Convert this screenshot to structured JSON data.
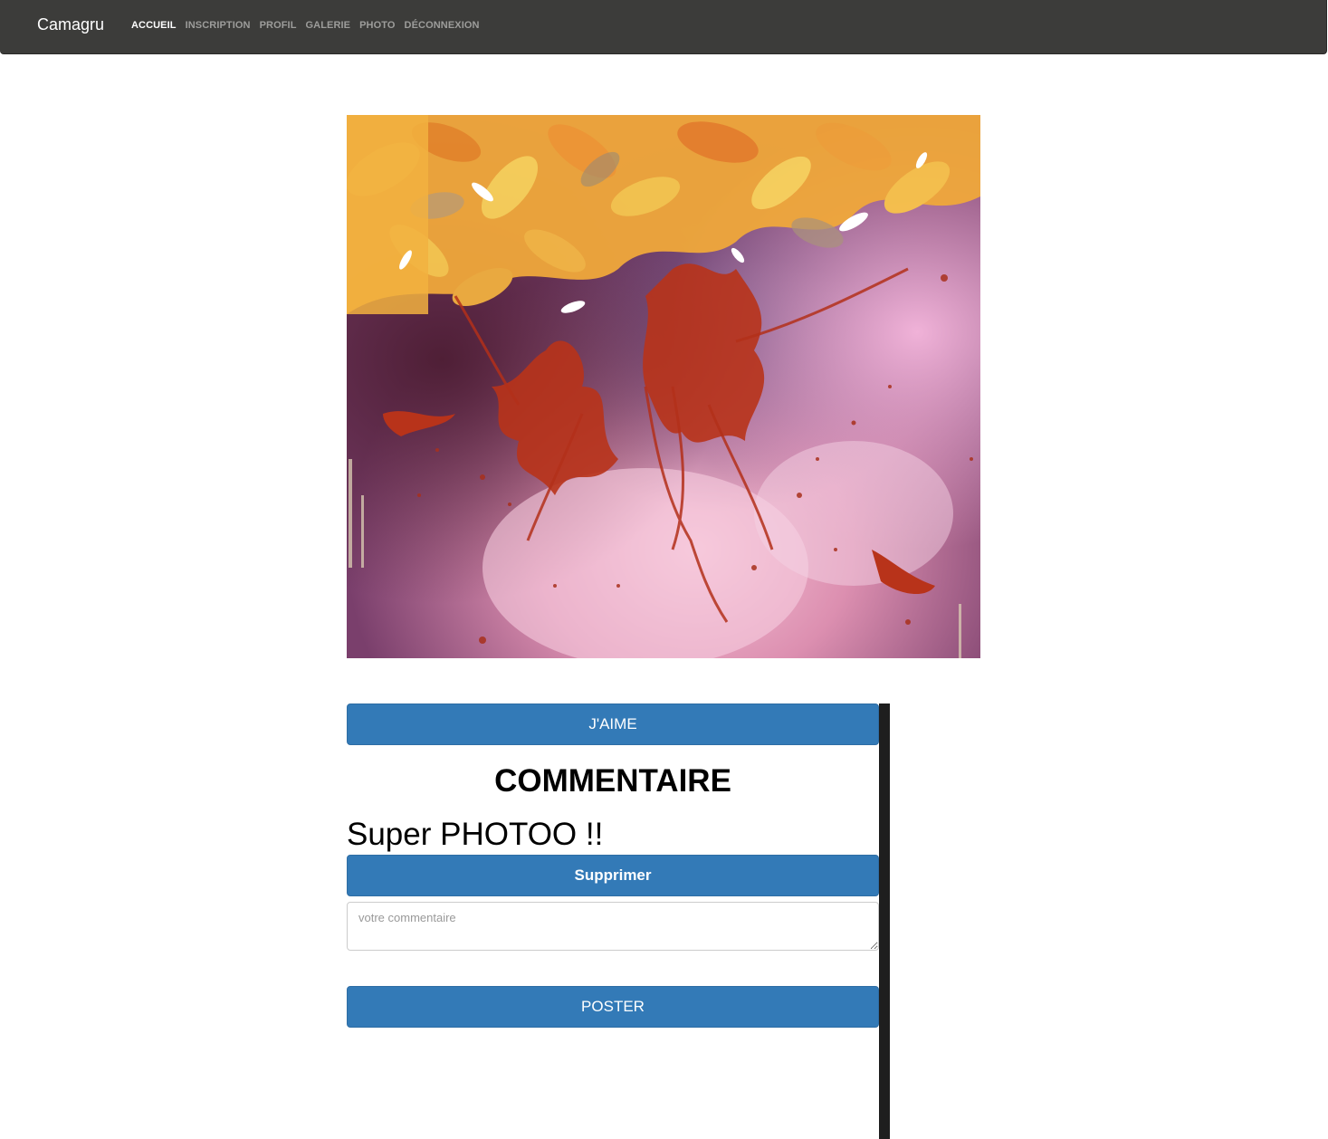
{
  "navbar": {
    "brand": "Camagru",
    "links": [
      {
        "label": "ACCUEIL",
        "active": true
      },
      {
        "label": "INSCRIPTION",
        "active": false
      },
      {
        "label": "PROFIL",
        "active": false
      },
      {
        "label": "GALERIE",
        "active": false
      },
      {
        "label": "PHOTO",
        "active": false
      },
      {
        "label": "DÉCONNEXION",
        "active": false
      }
    ]
  },
  "post": {
    "like_label": "J'AIME",
    "comments_heading": "COMMENTAIRE",
    "comments": [
      {
        "text": "Super PHOTOO !!",
        "delete_label": "Supprimer"
      }
    ],
    "comment_placeholder": "votre commentaire",
    "post_label": "POSTER"
  },
  "colors": {
    "navbar_bg": "#3c3c3a",
    "button_primary": "#337ab7",
    "side_bar": "#1e1e1e"
  }
}
